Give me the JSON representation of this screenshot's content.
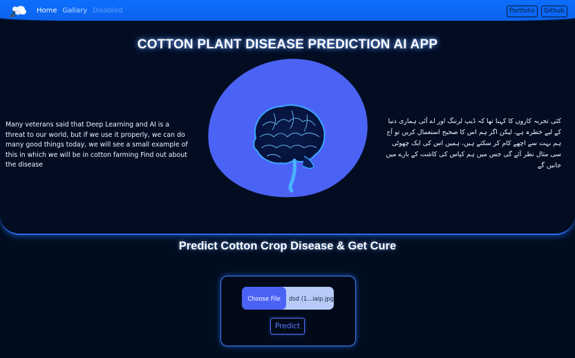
{
  "navbar": {
    "logo_icon": "cotton-plant-logo",
    "links": [
      {
        "label": "Home",
        "state": "active"
      },
      {
        "label": "Gallary",
        "state": "normal"
      },
      {
        "label": "Disabled",
        "state": "disabled"
      }
    ],
    "buttons": [
      {
        "label": "Portfolio"
      },
      {
        "label": "Github"
      }
    ]
  },
  "hero": {
    "title": "COTTON PLANT DISEASE PREDICTION AI APP",
    "text_en": "Many veterans said that Deep Learning and AI is a threat to our world, but if we use it properly, we can do many good things today, we will see a small example of this in which we will be in cotton farming Find out about the disease",
    "text_ur": "کئی تجربہ کاروں کا کہنا تھا کہ ڈیپ لرننگ اور اے آئی ہماری دنیا کے لیے خطرہ ہے، لیکن اگر ہم اس کا صحیح استعمال کریں تو آج ہم بہت سے اچھے کام کر سکتے ہیں، ہمیں اس کی ایک چھوٹی سی مثال نظر آئے گی جس میں ہم کپاس کی کاشت کے بارے میں جانیں گے",
    "image_icon": "brain-icon",
    "blob_color": "#4b63f5"
  },
  "predict": {
    "title": "Predict Cotton Crop Disease & Get Cure",
    "choose_file_label": "Choose File",
    "file_name": "dsd (1...iaip.jpg",
    "predict_label": "Predict"
  },
  "colors": {
    "navbar": "#0d6efd",
    "background": "#000d1f",
    "accent": "#4b63f5"
  }
}
